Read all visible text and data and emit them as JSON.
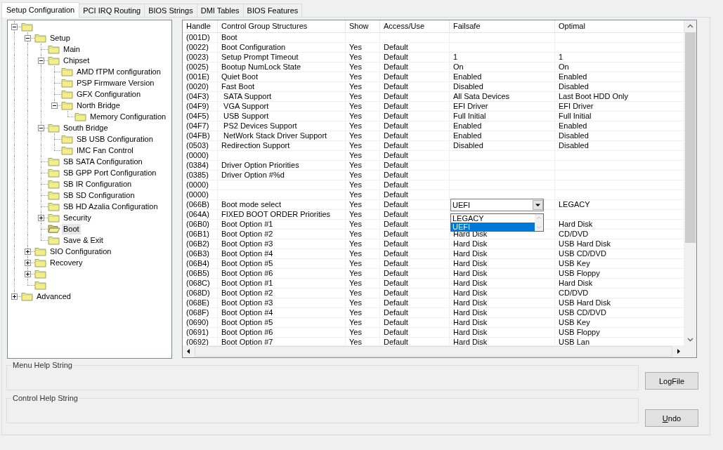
{
  "tabs": [
    {
      "label": "Setup Configuration",
      "selected": true
    },
    {
      "label": "PCI IRQ Routing",
      "selected": false
    },
    {
      "label": "BIOS Strings",
      "selected": false
    },
    {
      "label": "DMI Tables",
      "selected": false
    },
    {
      "label": "BIOS Features",
      "selected": false
    }
  ],
  "tree": {
    "items": [
      {
        "expanded": true,
        "selected": false,
        "children": [
          {
            "label": "Setup",
            "expanded": true,
            "selected": false,
            "children": [
              {
                "label": "Main",
                "selected": false
              },
              {
                "label": "Chipset",
                "expanded": true,
                "selected": false,
                "children": [
                  {
                    "label": "AMD fTPM configuration",
                    "selected": false
                  },
                  {
                    "label": "PSP Firmware Version",
                    "selected": false
                  },
                  {
                    "label": "GFX Configuration",
                    "selected": false
                  },
                  {
                    "label": "North Bridge",
                    "expanded": true,
                    "selected": false,
                    "children": [
                      {
                        "label": "Memory Configuration",
                        "selected": false
                      }
                    ]
                  }
                ]
              },
              {
                "label": "South Bridge",
                "expanded": true,
                "selected": false,
                "children": [
                  {
                    "label": "SB USB Configuration",
                    "selected": false
                  },
                  {
                    "label": "IMC Fan Control",
                    "selected": false
                  }
                ]
              },
              {
                "label": "SB SATA Configuration",
                "selected": false
              },
              {
                "label": "SB GPP Port Configuration",
                "selected": false
              },
              {
                "label": "SB IR Configuration",
                "selected": false
              },
              {
                "label": "SB SD Configuration",
                "selected": false
              },
              {
                "label": "SB HD Azalia Configuration",
                "selected": false
              },
              {
                "label": "Security",
                "expanded": false,
                "selected": false
              },
              {
                "label": "Boot",
                "selected": true
              },
              {
                "label": "Save & Exit",
                "selected": false
              }
            ]
          },
          {
            "label": "SIO Configuration",
            "expanded": false,
            "selected": false
          },
          {
            "label": "Recovery",
            "expanded": false,
            "selected": false
          },
          {
            "expanded": false,
            "selected": false
          },
          {
            "selected": false
          }
        ]
      },
      {
        "label": "Advanced",
        "expanded": false,
        "selected": false
      }
    ]
  },
  "table": {
    "columns": [
      "Handle",
      "Control Group Structures",
      "Show",
      "Access/Use",
      "Failsafe",
      "Optimal"
    ],
    "rows": [
      {
        "handle": "(001D)",
        "name": "Boot"
      },
      {
        "handle": "(0022)",
        "name": "Boot Configuration",
        "show": "Yes",
        "access": "Default"
      },
      {
        "handle": "(0023)",
        "name": "Setup Prompt Timeout",
        "show": "Yes",
        "access": "Default",
        "failsafe": "1",
        "optimal": "1"
      },
      {
        "handle": "(0025)",
        "name": "Bootup NumLock State",
        "show": "Yes",
        "access": "Default",
        "failsafe": "On",
        "optimal": "On"
      },
      {
        "handle": "(001E)",
        "name": "Quiet Boot",
        "show": "Yes",
        "access": "Default",
        "failsafe": "Enabled",
        "optimal": "Enabled"
      },
      {
        "handle": "(0020)",
        "name": "Fast Boot",
        "show": "Yes",
        "access": "Default",
        "failsafe": "Disabled",
        "optimal": "Disabled"
      },
      {
        "handle": "(04F3)",
        "name": " SATA Support",
        "show": "Yes",
        "access": "Default",
        "failsafe": "All Sata Devices",
        "optimal": "Last Boot HDD Only"
      },
      {
        "handle": "(04F9)",
        "name": " VGA Support",
        "show": "Yes",
        "access": "Default",
        "failsafe": "EFI Driver",
        "optimal": "EFI Driver"
      },
      {
        "handle": "(04F5)",
        "name": " USB Support",
        "show": "Yes",
        "access": "Default",
        "failsafe": "Full Initial",
        "optimal": "Full Initial"
      },
      {
        "handle": "(04F7)",
        "name": " PS2 Devices Support",
        "show": "Yes",
        "access": "Default",
        "failsafe": "Enabled",
        "optimal": "Enabled"
      },
      {
        "handle": "(04FB)",
        "name": " NetWork Stack Driver Support",
        "show": "Yes",
        "access": "Default",
        "failsafe": "Enabled",
        "optimal": "Disabled"
      },
      {
        "handle": "(0503)",
        "name": "Redirection Support",
        "show": "Yes",
        "access": "Default",
        "failsafe": "Disabled",
        "optimal": "Disabled"
      },
      {
        "handle": "(0000)",
        "show": "Yes",
        "access": "Default"
      },
      {
        "handle": "(0384)",
        "name": "Driver Option Priorities",
        "show": "Yes",
        "access": "Default"
      },
      {
        "handle": "(0385)",
        "name": "Driver Option #%d",
        "show": "Yes",
        "access": "Default"
      },
      {
        "handle": "(0000)",
        "show": "Yes",
        "access": "Default"
      },
      {
        "handle": "(0000)",
        "show": "Yes",
        "access": "Default"
      },
      {
        "handle": "(066B)",
        "name": "Boot mode select",
        "show": "Yes",
        "access": "Default",
        "optimal": "LEGACY",
        "dropdown": {
          "value": "UEFI",
          "expanded": true,
          "options": [
            {
              "label": "LEGACY",
              "selected": false
            },
            {
              "label": "UEFI",
              "selected": true
            }
          ]
        }
      },
      {
        "handle": "(064A)",
        "name": "FIXED BOOT ORDER Priorities",
        "show": "Yes",
        "access": "Default"
      },
      {
        "handle": "(06B0)",
        "name": "Boot Option #1",
        "show": "Yes",
        "access": "Default",
        "optimal": "Hard Disk"
      },
      {
        "handle": "(06B1)",
        "name": "Boot Option #2",
        "show": "Yes",
        "access": "Default",
        "failsafe": "Hard Disk",
        "optimal": "CD/DVD"
      },
      {
        "handle": "(06B2)",
        "name": "Boot Option #3",
        "show": "Yes",
        "access": "Default",
        "failsafe": "Hard Disk",
        "optimal": "USB Hard Disk"
      },
      {
        "handle": "(06B3)",
        "name": "Boot Option #4",
        "show": "Yes",
        "access": "Default",
        "failsafe": "Hard Disk",
        "optimal": "USB CD/DVD"
      },
      {
        "handle": "(06B4)",
        "name": "Boot Option #5",
        "show": "Yes",
        "access": "Default",
        "failsafe": "Hard Disk",
        "optimal": "USB Key"
      },
      {
        "handle": "(06B5)",
        "name": "Boot Option #6",
        "show": "Yes",
        "access": "Default",
        "failsafe": "Hard Disk",
        "optimal": "USB Floppy"
      },
      {
        "handle": "(068C)",
        "name": "Boot Option #1",
        "show": "Yes",
        "access": "Default",
        "failsafe": "Hard Disk",
        "optimal": "Hard Disk"
      },
      {
        "handle": "(068D)",
        "name": "Boot Option #2",
        "show": "Yes",
        "access": "Default",
        "failsafe": "Hard Disk",
        "optimal": "CD/DVD"
      },
      {
        "handle": "(068E)",
        "name": "Boot Option #3",
        "show": "Yes",
        "access": "Default",
        "failsafe": "Hard Disk",
        "optimal": "USB Hard Disk"
      },
      {
        "handle": "(068F)",
        "name": "Boot Option #4",
        "show": "Yes",
        "access": "Default",
        "failsafe": "Hard Disk",
        "optimal": "USB CD/DVD"
      },
      {
        "handle": "(0690)",
        "name": "Boot Option #5",
        "show": "Yes",
        "access": "Default",
        "failsafe": "Hard Disk",
        "optimal": "USB Key"
      },
      {
        "handle": "(0691)",
        "name": "Boot Option #6",
        "show": "Yes",
        "access": "Default",
        "failsafe": "Hard Disk",
        "optimal": "USB Floppy"
      },
      {
        "handle": "(0692)",
        "name": "Boot Option #7",
        "show": "Yes",
        "access": "Default",
        "failsafe": "Hard Disk",
        "optimal": "USB Lan"
      }
    ]
  },
  "help_groups": [
    {
      "title": "Menu Help String"
    },
    {
      "title": "Control Help String"
    }
  ],
  "buttons": [
    {
      "label": "LogFile",
      "kind": "plain"
    },
    {
      "label": "Undo",
      "kind": "mnemonic"
    }
  ]
}
